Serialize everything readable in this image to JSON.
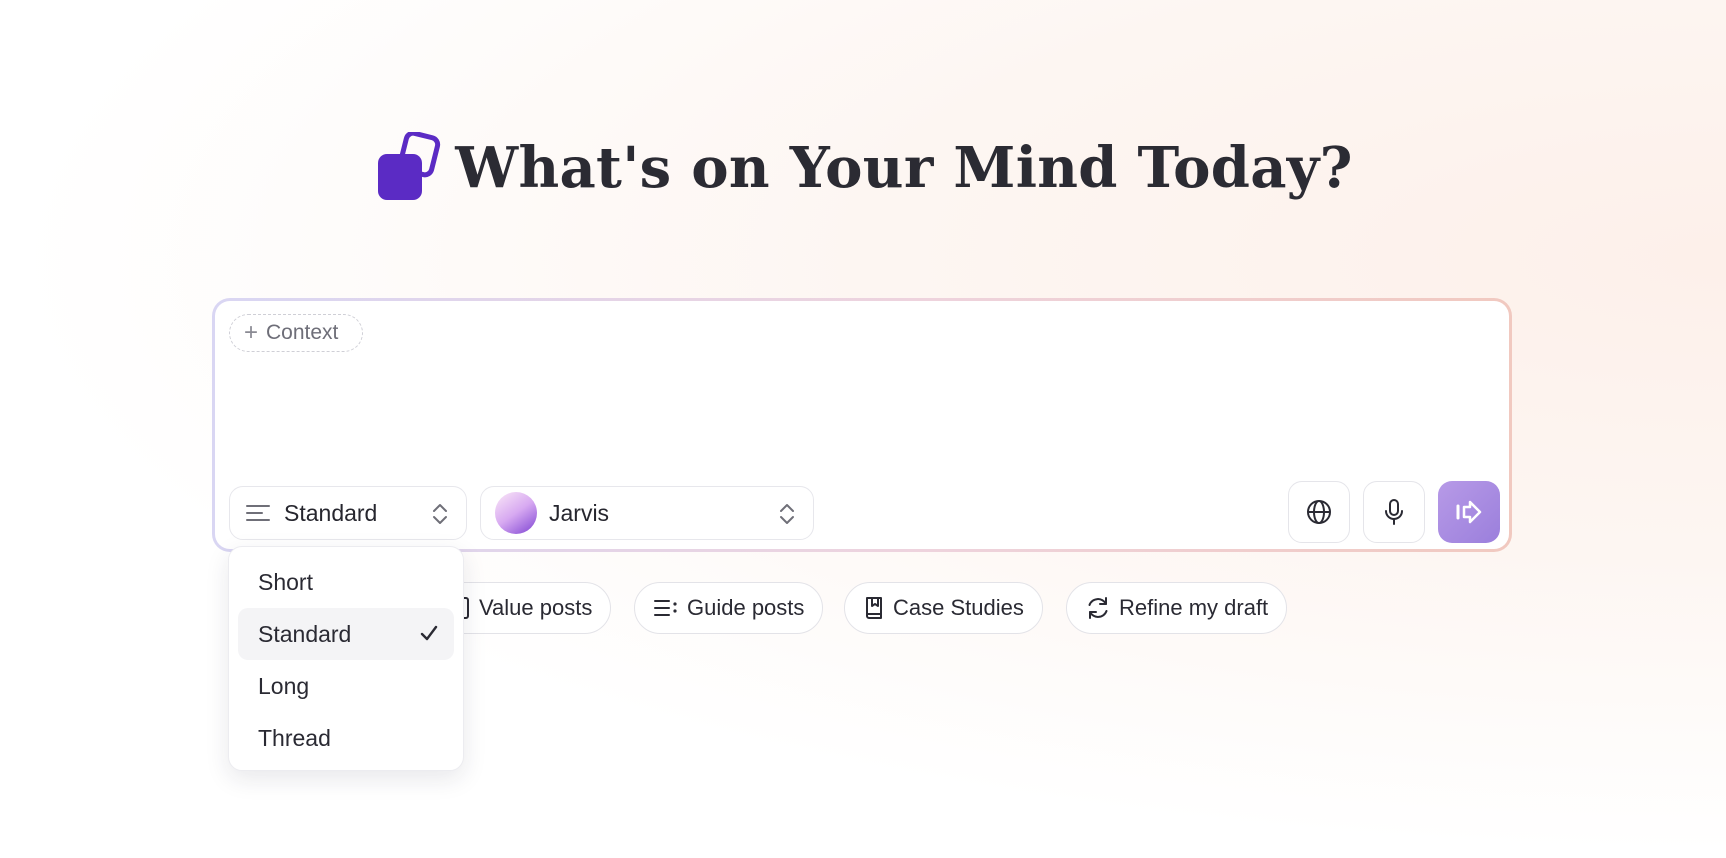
{
  "heading": {
    "title": "What's on Your Mind Today?"
  },
  "composer": {
    "context_label": "Context",
    "length_select": {
      "value": "Standard"
    },
    "persona_select": {
      "value": "Jarvis"
    },
    "send_button_color": "#9b7fdc"
  },
  "suggestions": [
    {
      "label": "Value posts",
      "icon": "document-icon"
    },
    {
      "label": "Guide posts",
      "icon": "list-icon"
    },
    {
      "label": "Case Studies",
      "icon": "bookmark-book-icon"
    },
    {
      "label": "Refine my draft",
      "icon": "refresh-icon"
    }
  ],
  "length_dropdown": {
    "options": [
      "Short",
      "Standard",
      "Long",
      "Thread"
    ],
    "selected": "Standard"
  },
  "colors": {
    "brand": "#5b2bc4",
    "accent": "#9b7fdc",
    "text": "#2a2a33"
  }
}
